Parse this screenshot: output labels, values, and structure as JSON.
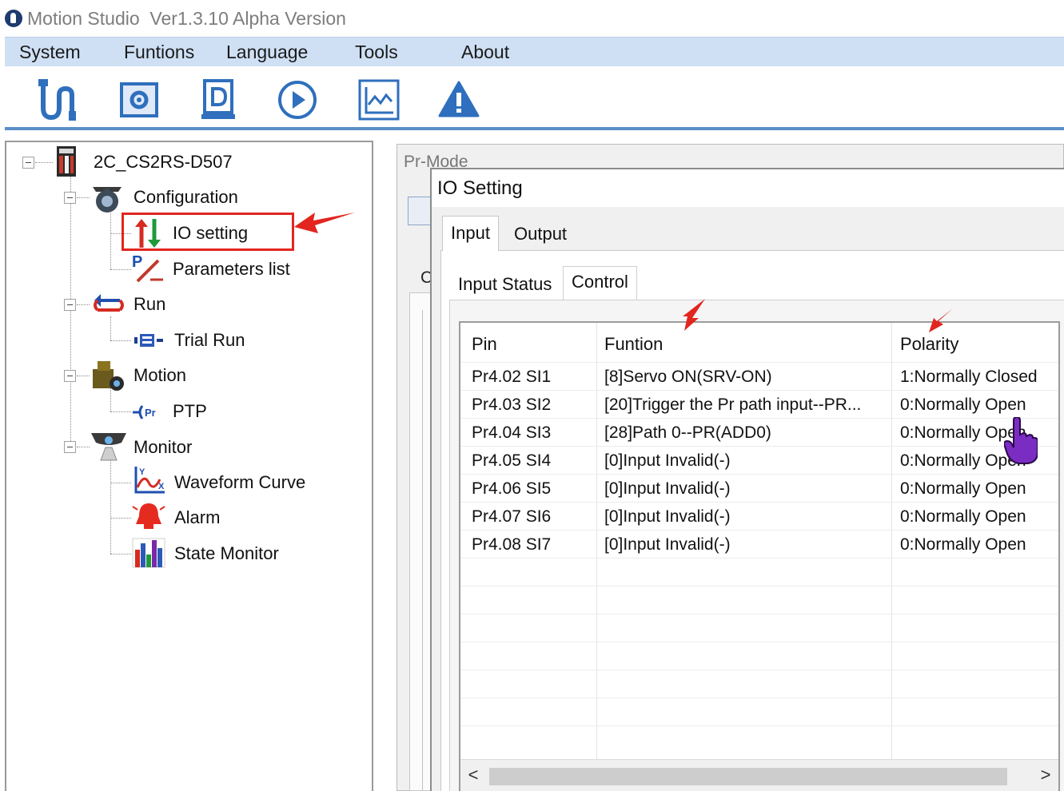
{
  "window": {
    "title": "Motion Studio  Ver1.3.10 Alpha Version",
    "logo_icon": "motion-studio-logo-icon"
  },
  "menu": {
    "items": [
      {
        "label": "System"
      },
      {
        "label": "Funtions"
      },
      {
        "label": "Language"
      },
      {
        "label": "Tools"
      },
      {
        "label": "About"
      }
    ]
  },
  "toolbar": {
    "buttons": [
      {
        "icon": "connect-cable-icon"
      },
      {
        "icon": "parameter-settings-icon"
      },
      {
        "icon": "document-d-icon"
      },
      {
        "icon": "play-run-icon"
      },
      {
        "icon": "waveform-chart-icon"
      },
      {
        "icon": "warning-alarm-icon"
      }
    ],
    "accent_color": "#2f6fbd"
  },
  "tree": {
    "root": {
      "label": "2C_CS2RS-D507",
      "icon": "drive-device-icon"
    },
    "groups": [
      {
        "label": "Configuration",
        "icon": "configuration-gear-icon",
        "children": [
          {
            "label": "IO setting",
            "icon": "io-arrows-icon",
            "highlighted": true
          },
          {
            "label": "Parameters list",
            "icon": "parameters-list-icon"
          }
        ]
      },
      {
        "label": "Run",
        "icon": "run-loop-icon",
        "children": [
          {
            "label": "Trial Run",
            "icon": "trial-run-icon"
          }
        ]
      },
      {
        "label": "Motion",
        "icon": "motion-icon",
        "children": [
          {
            "label": "PTP",
            "icon": "ptp-icon"
          }
        ]
      },
      {
        "label": "Monitor",
        "icon": "monitor-icon",
        "children": [
          {
            "label": "Waveform Curve",
            "icon": "waveform-curve-icon"
          },
          {
            "label": "Alarm",
            "icon": "alarm-bell-icon"
          },
          {
            "label": "State Monitor",
            "icon": "state-monitor-icon"
          }
        ]
      }
    ],
    "highlight_color": "#e2251f"
  },
  "background_window": {
    "tab_label": "Pr-Mode",
    "partial_label": "C"
  },
  "dialog": {
    "title": "IO Setting",
    "tabs": [
      {
        "label": "Input",
        "active": true
      },
      {
        "label": "Output",
        "active": false
      }
    ],
    "subtabs": [
      {
        "label": "Input Status",
        "active": false
      },
      {
        "label": "Control",
        "active": true
      }
    ],
    "table": {
      "columns": [
        "Pin",
        "Funtion",
        "Polarity"
      ],
      "rows": [
        [
          "Pr4.02 SI1",
          "[8]Servo ON(SRV-ON)",
          "1:Normally Closed"
        ],
        [
          "Pr4.03 SI2",
          "[20]Trigger the Pr path input--PR...",
          "0:Normally Open"
        ],
        [
          "Pr4.04 SI3",
          "[28]Path 0--PR(ADD0)",
          "0:Normally Open"
        ],
        [
          "Pr4.05 SI4",
          "[0]Input Invalid(-)",
          "0:Normally Open"
        ],
        [
          "Pr4.06 SI5",
          "[0]Input Invalid(-)",
          "0:Normally Open"
        ],
        [
          "Pr4.07 SI6",
          "[0]Input Invalid(-)",
          "0:Normally Open"
        ],
        [
          "Pr4.08 SI7",
          "[0]Input Invalid(-)",
          "0:Normally Open"
        ]
      ],
      "empty_rows": 7
    },
    "scrollbar": {
      "left_arrow": "<",
      "right_arrow": ">"
    }
  },
  "annotations": {
    "arrow_color": "#e2251f",
    "arrow_icon": "red-pointer-arrow-icon",
    "cursor_icon": "hand-cursor-icon"
  }
}
